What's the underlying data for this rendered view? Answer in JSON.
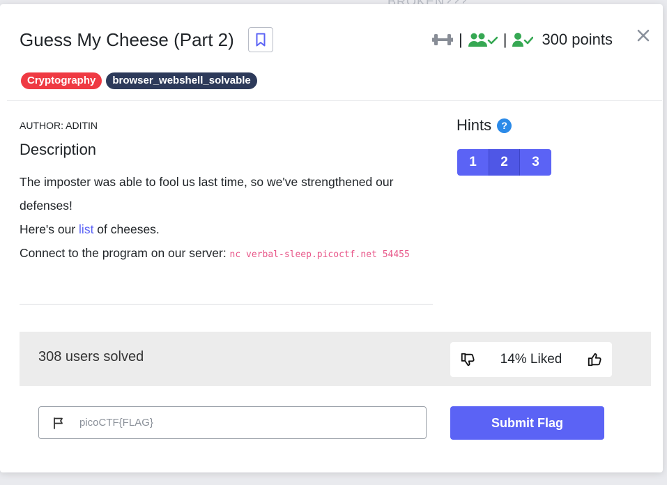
{
  "backdrop": {
    "partial_text": "BROKEN???"
  },
  "challenge": {
    "title": "Guess My Cheese (Part 2)",
    "points_label": "300 points",
    "separator": "|",
    "tags": [
      {
        "label": "Cryptography",
        "color": "#ef3a43"
      },
      {
        "label": "browser_webshell_solvable",
        "color": "#2d3a5a"
      }
    ],
    "author": "AUTHOR: ADITIN",
    "description_heading": "Description",
    "description": {
      "line1": "The imposter was able to fool us last time, so we've strengthened our defenses!",
      "line2_prefix": "Here's our ",
      "line2_link": "list",
      "line2_suffix": " of cheeses.",
      "line3_prefix": "Connect to the program on our server: ",
      "line3_code": "nc verbal-sleep.picoctf.net 54455"
    }
  },
  "hints": {
    "heading": "Hints",
    "help_glyph": "?",
    "buttons": [
      "1",
      "2",
      "3"
    ]
  },
  "stats": {
    "solved": "308 users solved",
    "liked": "14% Liked"
  },
  "flag": {
    "placeholder": "picoCTF{FLAG}",
    "value": "",
    "submit_label": "Submit Flag"
  },
  "colors": {
    "accent": "#5b63f5",
    "success_green": "#36a853",
    "tag_red": "#ef3a43",
    "tag_dark": "#2d3a5a",
    "code_pink": "#e8588a"
  },
  "icons": {
    "difficulty": "dumbbell-icon",
    "team_solved": "users-check-icon",
    "user_solved": "user-check-icon",
    "bookmark": "bookmark-icon",
    "close": "close-icon",
    "thumbs_down": "thumbs-down-icon",
    "thumbs_up": "thumbs-up-icon",
    "flag": "flag-icon",
    "help": "question-circle-icon"
  }
}
